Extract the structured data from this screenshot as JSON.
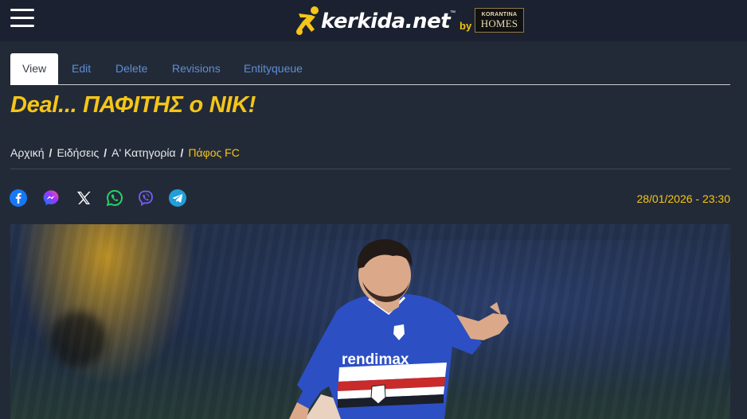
{
  "header": {
    "logo_text": "kerkida.net",
    "logo_tm": "™",
    "logo_by": "by",
    "partner_line1": "KORANTINA",
    "partner_line2": "HOMES"
  },
  "tabs": [
    {
      "label": "View",
      "active": true
    },
    {
      "label": "Edit",
      "active": false
    },
    {
      "label": "Delete",
      "active": false
    },
    {
      "label": "Revisions",
      "active": false
    },
    {
      "label": "Entityqueue",
      "active": false
    }
  ],
  "article": {
    "title": "Deal... ΠΑΦΙΤΗΣ ο ΝΙΚ!",
    "date": "28/01/2026 - 23:30",
    "photo_shirt_text": "rendimax"
  },
  "breadcrumb": [
    {
      "label": "Αρχική"
    },
    {
      "label": "Ειδήσεις"
    },
    {
      "label": "Α' Κατηγορία"
    },
    {
      "label": "Πάφος FC"
    }
  ],
  "share_icons": [
    "facebook-icon",
    "messenger-icon",
    "x-icon",
    "whatsapp-icon",
    "viber-icon",
    "telegram-icon"
  ],
  "colors": {
    "background": "#232a37",
    "header": "#1b2130",
    "accent_yellow": "#f5c518",
    "link_blue": "#5d8ed6"
  }
}
